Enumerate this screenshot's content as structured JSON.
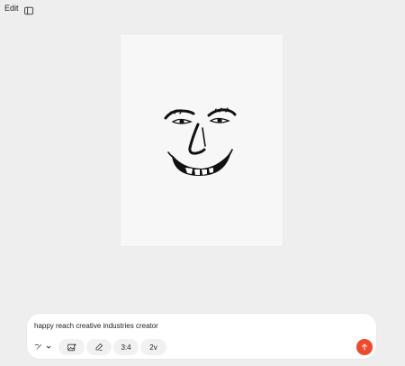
{
  "header": {
    "edit_label": "Edit",
    "panel_icon": "sidebar-panel-icon"
  },
  "canvas": {
    "image_subject": "smiley-face-drawing"
  },
  "composer": {
    "prompt_text": "happy reach creative industries creator",
    "style_icon": "pen-nib-icon",
    "style_dropdown_icon": "chevron-down-icon",
    "image_icon": "image-add-icon",
    "draw_icon": "brush-icon",
    "aspect_ratio": "3:4",
    "variants": "2v",
    "send_icon": "arrow-up-icon",
    "accent_color": "#ee4a2b"
  }
}
